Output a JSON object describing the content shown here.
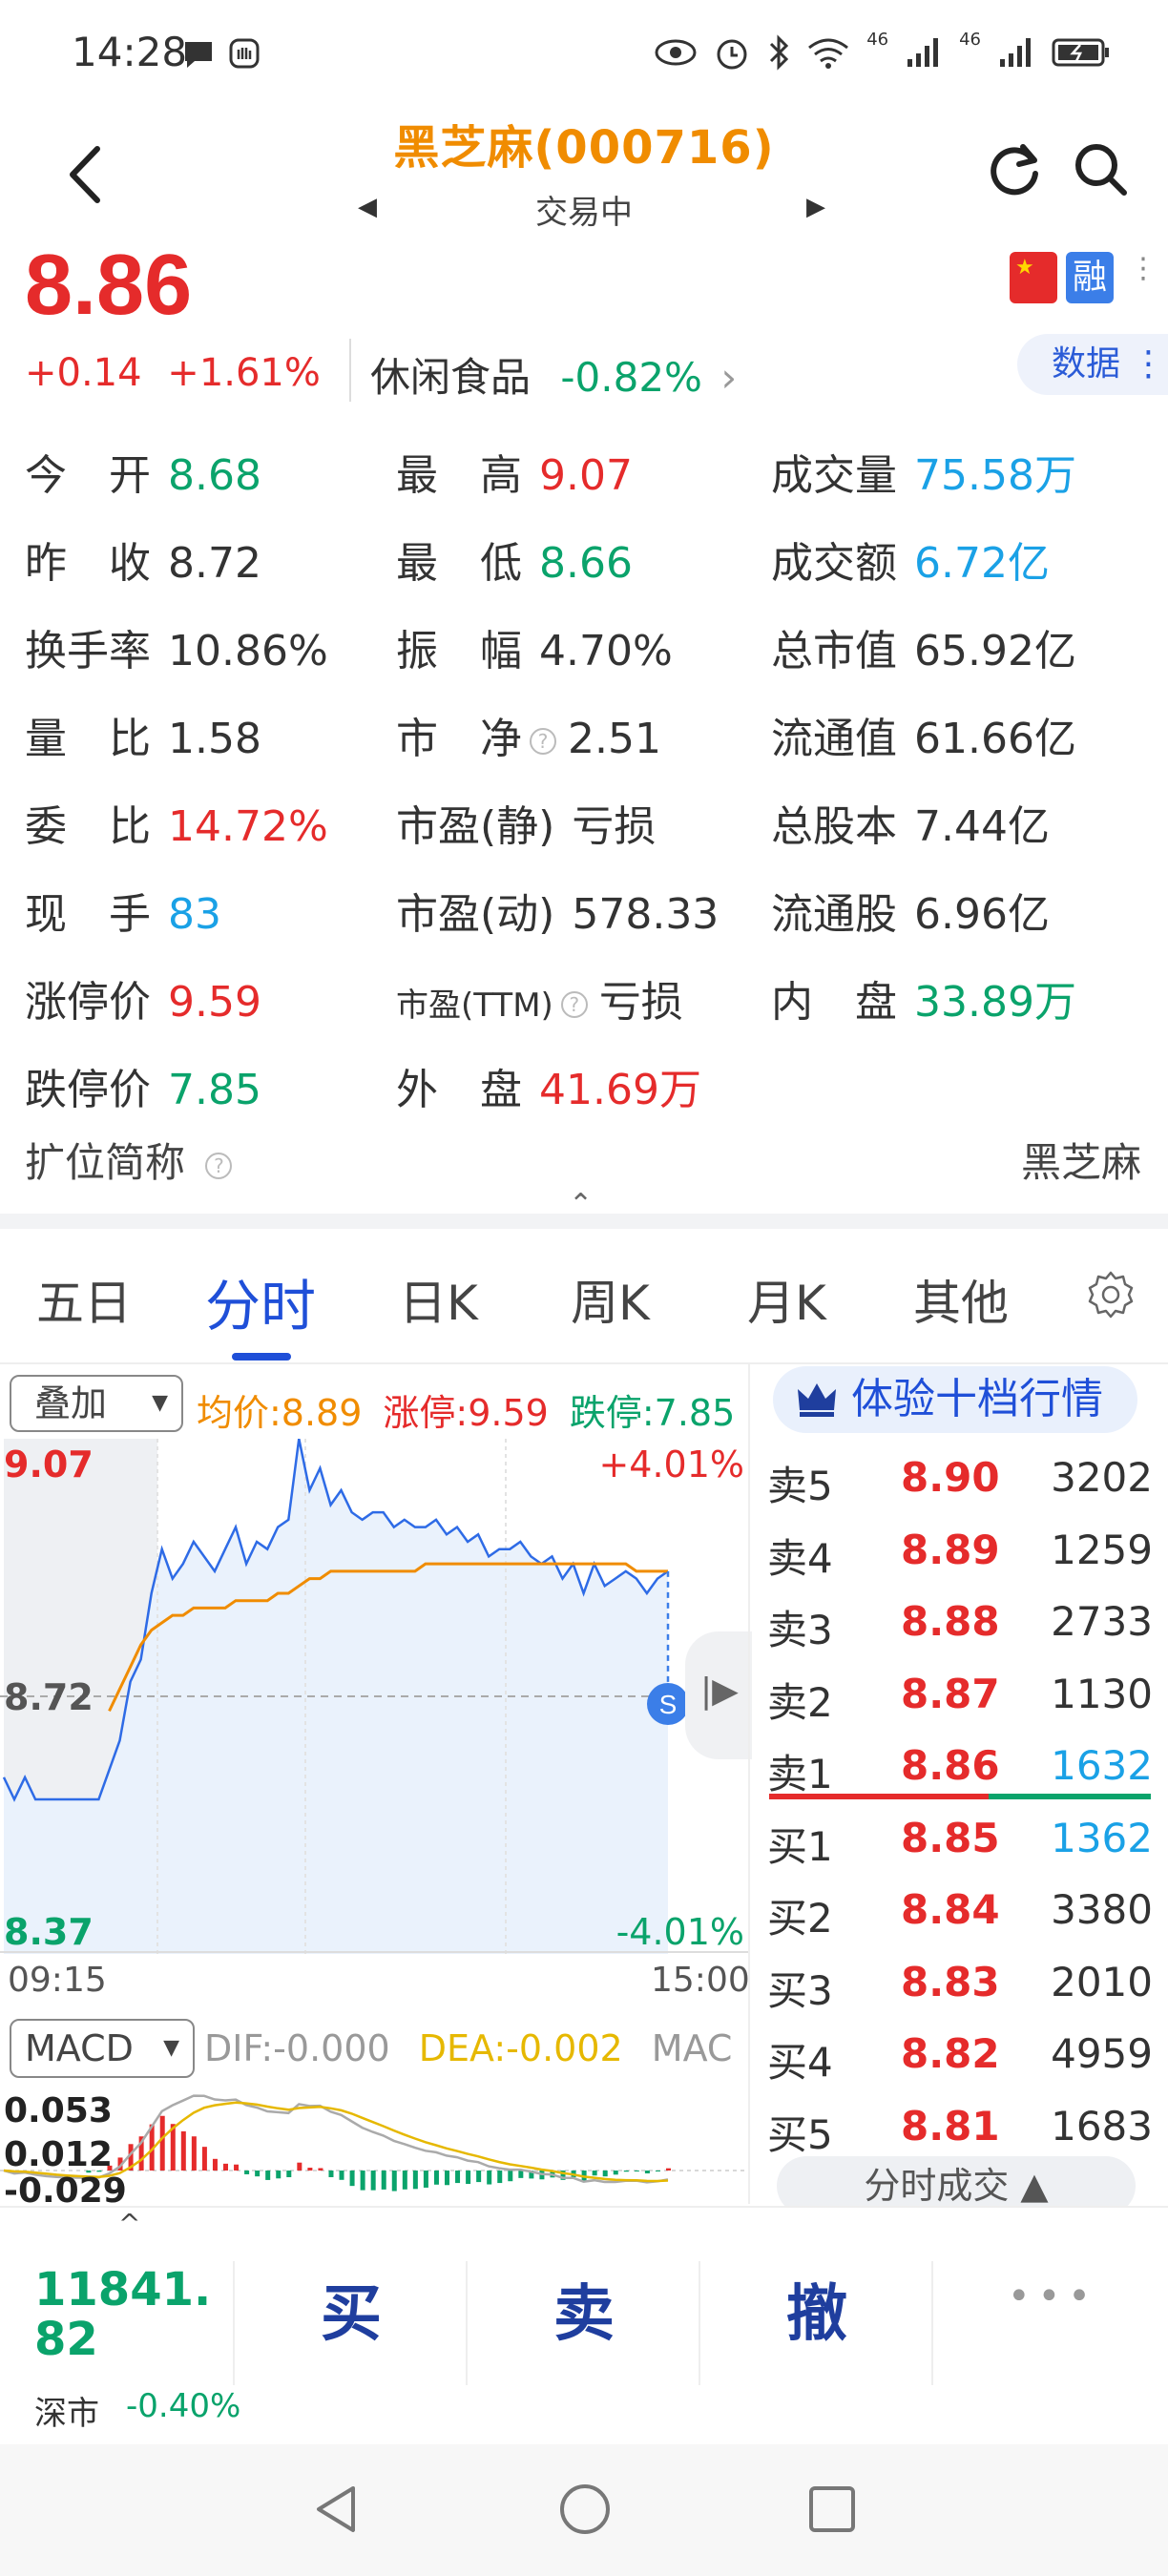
{
  "status_bar": {
    "time": "14:28",
    "signal_1": "46",
    "signal_2": "46"
  },
  "header": {
    "title": "黑芝麻(000716)",
    "subtitle": "交易中",
    "prev_arrow": "◀",
    "next_arrow": "▶"
  },
  "quote": {
    "price": "8.86",
    "change": "+0.14",
    "change_pct": "+1.61%",
    "sector": "休闲食品",
    "sector_pct": "-0.82%",
    "sector_chevron": "›",
    "data_button": "数据",
    "rong_badge": "融",
    "more_dots": "⋮"
  },
  "stats": {
    "col1": [
      {
        "label": "今　开",
        "value": "8.68",
        "color": "green"
      },
      {
        "label": "昨　收",
        "value": "8.72",
        "color": "dark"
      },
      {
        "label": "换手率",
        "value": "10.86%",
        "color": "dark"
      },
      {
        "label": "量　比",
        "value": "1.58",
        "color": "dark"
      },
      {
        "label": "委　比",
        "value": "14.72%",
        "color": "red"
      },
      {
        "label": "现　手",
        "value": "83",
        "color": "blue"
      },
      {
        "label": "涨停价",
        "value": "9.59",
        "color": "red"
      },
      {
        "label": "跌停价",
        "value": "7.85",
        "color": "green"
      }
    ],
    "col2": [
      {
        "label": "最　高",
        "value": "9.07",
        "color": "red"
      },
      {
        "label": "最　低",
        "value": "8.66",
        "color": "green"
      },
      {
        "label": "振　幅",
        "value": "4.70%",
        "color": "dark"
      },
      {
        "label": "市　净",
        "value": "2.51",
        "color": "dark",
        "help": true
      },
      {
        "label": "市盈(静)",
        "value": "亏损",
        "color": "dark"
      },
      {
        "label": "市盈(动)",
        "value": "578.33",
        "color": "dark"
      },
      {
        "label": "市盈(TTM)",
        "value": "亏损",
        "color": "dark",
        "help": true,
        "small": true
      },
      {
        "label": "外　盘",
        "value": "41.69万",
        "color": "red"
      }
    ],
    "col3": [
      {
        "label": "成交量",
        "value": "75.58万",
        "color": "blue"
      },
      {
        "label": "成交额",
        "value": "6.72亿",
        "color": "blue"
      },
      {
        "label": "总市值",
        "value": "65.92亿",
        "color": "dark"
      },
      {
        "label": "流通值",
        "value": "61.66亿",
        "color": "dark"
      },
      {
        "label": "总股本",
        "value": "7.44亿",
        "color": "dark"
      },
      {
        "label": "流通股",
        "value": "6.96亿",
        "color": "dark"
      },
      {
        "label": "内　盘",
        "value": "33.89万",
        "color": "green"
      }
    ],
    "short_name_label": "扩位简称",
    "short_name_value": "黑芝麻",
    "help_glyph": "?",
    "collapse_caret": "⌃"
  },
  "tabs": [
    {
      "label": "五日",
      "active": false
    },
    {
      "label": "分时",
      "active": true
    },
    {
      "label": "日K",
      "active": false
    },
    {
      "label": "周K",
      "active": false
    },
    {
      "label": "月K",
      "active": false
    },
    {
      "label": "其他",
      "active": false
    }
  ],
  "chart": {
    "overlay_label": "叠加",
    "dropdown_glyph": "▼",
    "legend_avg": "均价:8.89",
    "legend_up": "涨停:9.59",
    "legend_down": "跌停:7.85",
    "y_high": "9.07",
    "y_mid": "8.72",
    "y_low": "8.37",
    "pct_high": "+4.01%",
    "pct_low": "-4.01%",
    "time_start": "09:15",
    "time_end": "15:00",
    "marker_label": "S",
    "play_glyph": "|▶",
    "macd_label": "MACD",
    "dif": "DIF:-0.000",
    "dea": "DEA:-0.002",
    "macd_tail": "MAC",
    "macd_ticks": [
      "0.053",
      "0.012",
      "-0.029"
    ]
  },
  "chart_data": {
    "type": "line",
    "x_range": [
      "09:15",
      "15:00"
    ],
    "ylim": [
      8.37,
      9.07
    ],
    "prev_close": 8.72,
    "series": [
      {
        "values": [
          8.61,
          8.58,
          8.61,
          8.58,
          8.58,
          8.58,
          8.58,
          8.58,
          8.58,
          8.58,
          8.62,
          8.66,
          8.74,
          8.77,
          8.86,
          8.92,
          8.88,
          8.9,
          8.93,
          8.91,
          8.89,
          8.92,
          8.95,
          8.9,
          8.93,
          8.92,
          8.95,
          8.96,
          9.07,
          9.0,
          9.03,
          8.98,
          9.0,
          8.97,
          8.96,
          8.97,
          8.97,
          8.95,
          8.96,
          8.95,
          8.95,
          8.96,
          8.94,
          8.95,
          8.93,
          8.94,
          8.91,
          8.92,
          8.92,
          8.93,
          8.91,
          8.9,
          8.91,
          8.88,
          8.9,
          8.86,
          8.9,
          8.87,
          8.88,
          8.89,
          8.88,
          8.86,
          8.88,
          8.89
        ]
      },
      {
        "values": [
          null,
          null,
          null,
          null,
          null,
          null,
          null,
          null,
          null,
          null,
          8.7,
          8.73,
          8.76,
          8.79,
          8.81,
          8.82,
          8.83,
          8.83,
          8.84,
          8.84,
          8.84,
          8.84,
          8.85,
          8.85,
          8.85,
          8.85,
          8.86,
          8.86,
          8.87,
          8.88,
          8.88,
          8.89,
          8.89,
          8.89,
          8.89,
          8.89,
          8.89,
          8.89,
          8.89,
          8.89,
          8.9,
          8.9,
          8.9,
          8.9,
          8.9,
          8.9,
          8.9,
          8.9,
          8.9,
          8.9,
          8.9,
          8.9,
          8.9,
          8.9,
          8.9,
          8.9,
          8.9,
          8.9,
          8.9,
          8.9,
          8.89,
          8.89,
          8.89,
          8.89
        ]
      }
    ]
  },
  "orderbook": {
    "vip_label": "体验十档行情",
    "sell": [
      {
        "label": "卖5",
        "price": "8.90",
        "qty": "3202"
      },
      {
        "label": "卖4",
        "price": "8.89",
        "qty": "1259"
      },
      {
        "label": "卖3",
        "price": "8.88",
        "qty": "2733"
      },
      {
        "label": "卖2",
        "price": "8.87",
        "qty": "1130"
      },
      {
        "label": "卖1",
        "price": "8.86",
        "qty": "1632",
        "qty_color": "blue"
      }
    ],
    "buy": [
      {
        "label": "买1",
        "price": "8.85",
        "qty": "1362",
        "qty_color": "blue"
      },
      {
        "label": "买2",
        "price": "8.84",
        "qty": "3380"
      },
      {
        "label": "买3",
        "price": "8.83",
        "qty": "2010"
      },
      {
        "label": "买4",
        "price": "8.82",
        "qty": "4959"
      },
      {
        "label": "买5",
        "price": "8.81",
        "qty": "1683"
      }
    ],
    "time_trade": "分时成交 ▲"
  },
  "bottom": {
    "index_value": "11841.82",
    "index_name": "深市",
    "index_pct": "-0.40%",
    "up_caret": "^",
    "buy": "买",
    "sell": "卖",
    "cancel": "撤",
    "more": "•••"
  },
  "colors": {
    "red": "#e52b2b",
    "green": "#0aa36b",
    "blue": "#1aa1e6",
    "accent": "#1f4fd8",
    "orange": "#f08c00"
  }
}
